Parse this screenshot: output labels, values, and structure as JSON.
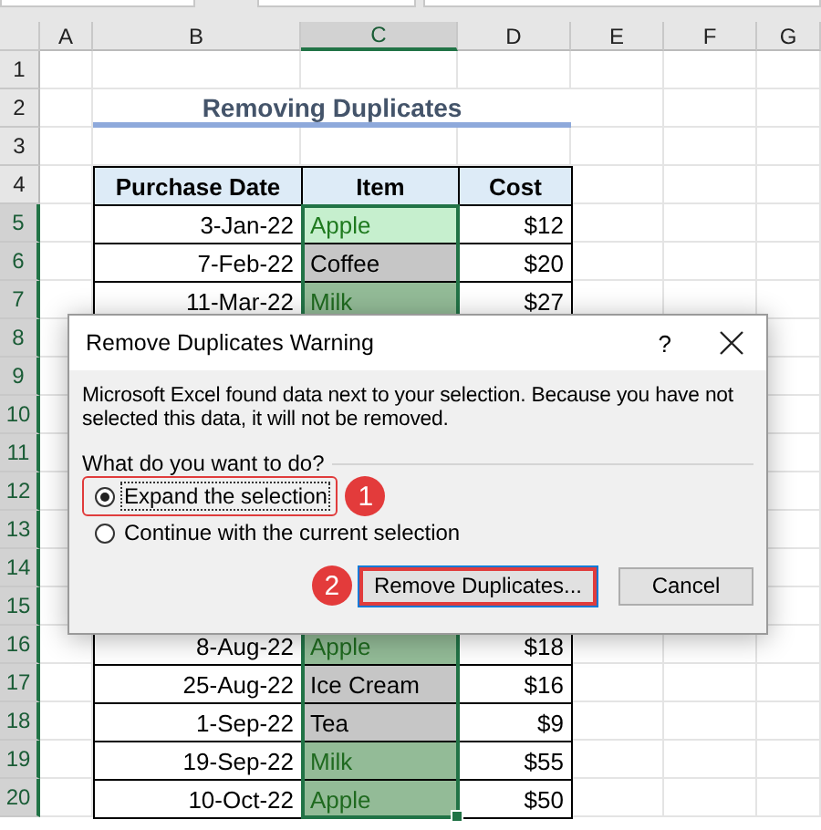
{
  "columns": [
    {
      "label": "A",
      "selected": false
    },
    {
      "label": "B",
      "selected": false
    },
    {
      "label": "C",
      "selected": true
    },
    {
      "label": "D",
      "selected": false
    },
    {
      "label": "E",
      "selected": false
    },
    {
      "label": "F",
      "selected": false
    },
    {
      "label": "G",
      "selected": false
    }
  ],
  "row_headers": [
    {
      "label": "1",
      "selected": false
    },
    {
      "label": "2",
      "selected": false
    },
    {
      "label": "3",
      "selected": false
    },
    {
      "label": "4",
      "selected": false
    },
    {
      "label": "5",
      "selected": true
    },
    {
      "label": "6",
      "selected": true
    },
    {
      "label": "7",
      "selected": true
    },
    {
      "label": "8",
      "selected": true
    },
    {
      "label": "9",
      "selected": true
    },
    {
      "label": "10",
      "selected": true
    },
    {
      "label": "11",
      "selected": true
    },
    {
      "label": "12",
      "selected": true
    },
    {
      "label": "13",
      "selected": true
    },
    {
      "label": "14",
      "selected": true
    },
    {
      "label": "15",
      "selected": true
    },
    {
      "label": "16",
      "selected": true
    },
    {
      "label": "17",
      "selected": true
    },
    {
      "label": "18",
      "selected": true
    },
    {
      "label": "19",
      "selected": true
    },
    {
      "label": "20",
      "selected": true
    }
  ],
  "sheet_title": "Removing Duplicates",
  "table": {
    "columns": [
      "Purchase Date",
      "Item",
      "Cost"
    ],
    "rows": [
      {
        "date": "3-Jan-22",
        "item": "Apple",
        "cost": "$12",
        "duplicate": true,
        "active": true
      },
      {
        "date": "7-Feb-22",
        "item": "Coffee",
        "cost": "$20",
        "duplicate": false,
        "active": false
      },
      {
        "date": "11-Mar-22",
        "item": "Milk",
        "cost": "$27",
        "duplicate": true,
        "active": false
      },
      {
        "date": "8-Aug-22",
        "item": "Apple",
        "cost": "$18",
        "duplicate": true,
        "active": false
      },
      {
        "date": "25-Aug-22",
        "item": "Ice Cream",
        "cost": "$16",
        "duplicate": false,
        "active": false
      },
      {
        "date": "1-Sep-22",
        "item": "Tea",
        "cost": "$9",
        "duplicate": false,
        "active": false
      },
      {
        "date": "19-Sep-22",
        "item": "Milk",
        "cost": "$55",
        "duplicate": true,
        "active": false
      },
      {
        "date": "10-Oct-22",
        "item": "Apple",
        "cost": "$50",
        "duplicate": true,
        "active": false
      }
    ]
  },
  "dialog": {
    "title": "Remove Duplicates Warning",
    "help": "?",
    "message": "Microsoft Excel found data next to your selection. Because you have not selected this data, it will not be removed.",
    "question": "What do you want to do?",
    "options": [
      {
        "label": "Expand the selection",
        "selected": true,
        "badge": "1"
      },
      {
        "label": "Continue with the current selection",
        "selected": false
      }
    ],
    "buttons": [
      {
        "label": "Remove Duplicates...",
        "kind": "primary",
        "badge": "2"
      },
      {
        "label": "Cancel",
        "kind": "normal"
      }
    ]
  }
}
